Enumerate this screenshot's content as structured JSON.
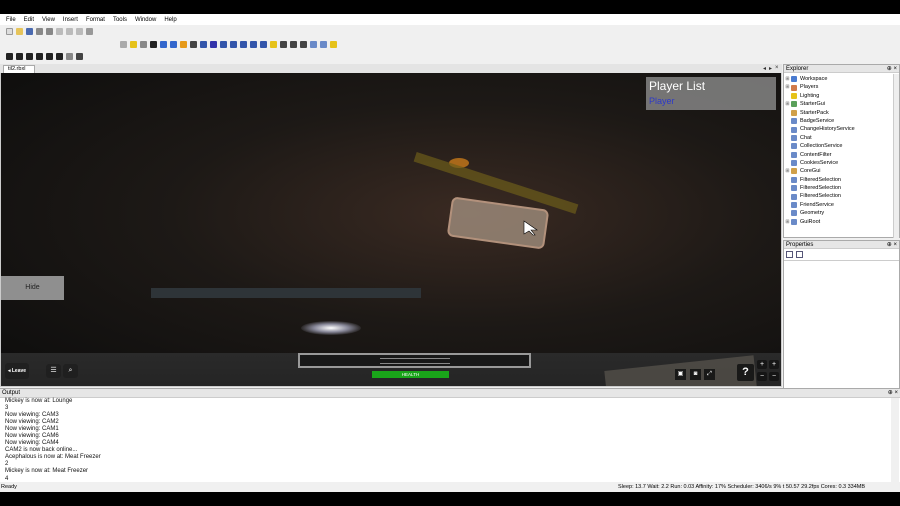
{
  "menu": [
    "File",
    "Edit",
    "View",
    "Insert",
    "Format",
    "Tools",
    "Window",
    "Help"
  ],
  "document_tab": "til2.rbxl",
  "tab_controls": {
    "left": "◂",
    "right": "▸",
    "close": "×"
  },
  "game": {
    "player_list_title": "Player List",
    "player_list_entry": "Player",
    "hide_label": "Hide",
    "leave_label": "Leave",
    "health_label": "HEALTH",
    "help_label": "?",
    "zoom_in": "+",
    "zoom_out": "−"
  },
  "explorer": {
    "title": "Explorer",
    "items": [
      {
        "label": "Workspace",
        "expander": "⊞",
        "color": "#4a7bd0"
      },
      {
        "label": "Players",
        "expander": "⊞",
        "color": "#d07a4a"
      },
      {
        "label": "Lighting",
        "expander": "",
        "color": "#e6c21a"
      },
      {
        "label": "StarterGui",
        "expander": "⊞",
        "color": "#5aa05a"
      },
      {
        "label": "StarterPack",
        "expander": "",
        "color": "#d0a04a"
      },
      {
        "label": "BadgeService",
        "expander": "",
        "color": "#6a8ac8"
      },
      {
        "label": "ChangeHistoryService",
        "expander": "",
        "color": "#6a8ac8"
      },
      {
        "label": "Chat",
        "expander": "",
        "color": "#6a8ac8"
      },
      {
        "label": "CollectionService",
        "expander": "",
        "color": "#6a8ac8"
      },
      {
        "label": "ContentFilter",
        "expander": "",
        "color": "#6a8ac8"
      },
      {
        "label": "CookiesService",
        "expander": "",
        "color": "#6a8ac8"
      },
      {
        "label": "CoreGui",
        "expander": "⊞",
        "color": "#d0a04a"
      },
      {
        "label": "FilteredSelection",
        "expander": "",
        "color": "#6a8ac8"
      },
      {
        "label": "FilteredSelection",
        "expander": "",
        "color": "#6a8ac8"
      },
      {
        "label": "FilteredSelection",
        "expander": "",
        "color": "#6a8ac8"
      },
      {
        "label": "FriendService",
        "expander": "",
        "color": "#6a8ac8"
      },
      {
        "label": "Geometry",
        "expander": "",
        "color": "#6a8ac8"
      },
      {
        "label": "GuiRoot",
        "expander": "⊞",
        "color": "#6a8ac8"
      }
    ]
  },
  "properties": {
    "title": "Properties"
  },
  "output": {
    "title": "Output",
    "lines": [
      "Mickey is now at: Lounge",
      "3",
      "Now viewing: CAM3",
      "Now viewing: CAM2",
      "Now viewing: CAM1",
      "Now viewing: CAM6",
      "Now viewing: CAM4",
      "CAM2 is now back online...",
      "Acephalous is now at: Meat Freezer",
      "2",
      "Mickey is now at: Meat Freezer",
      "4"
    ]
  },
  "status": {
    "left": "Ready",
    "right": "Sleep: 13.7 Wait: 2.2 Run: 0.03 Affinity: 17% Scheduler: 3406/s 9%        t 50.57    29.2fps    Cores: 0.3    334MB"
  },
  "panel_controls": {
    "pin": "⊕",
    "close": "×"
  }
}
